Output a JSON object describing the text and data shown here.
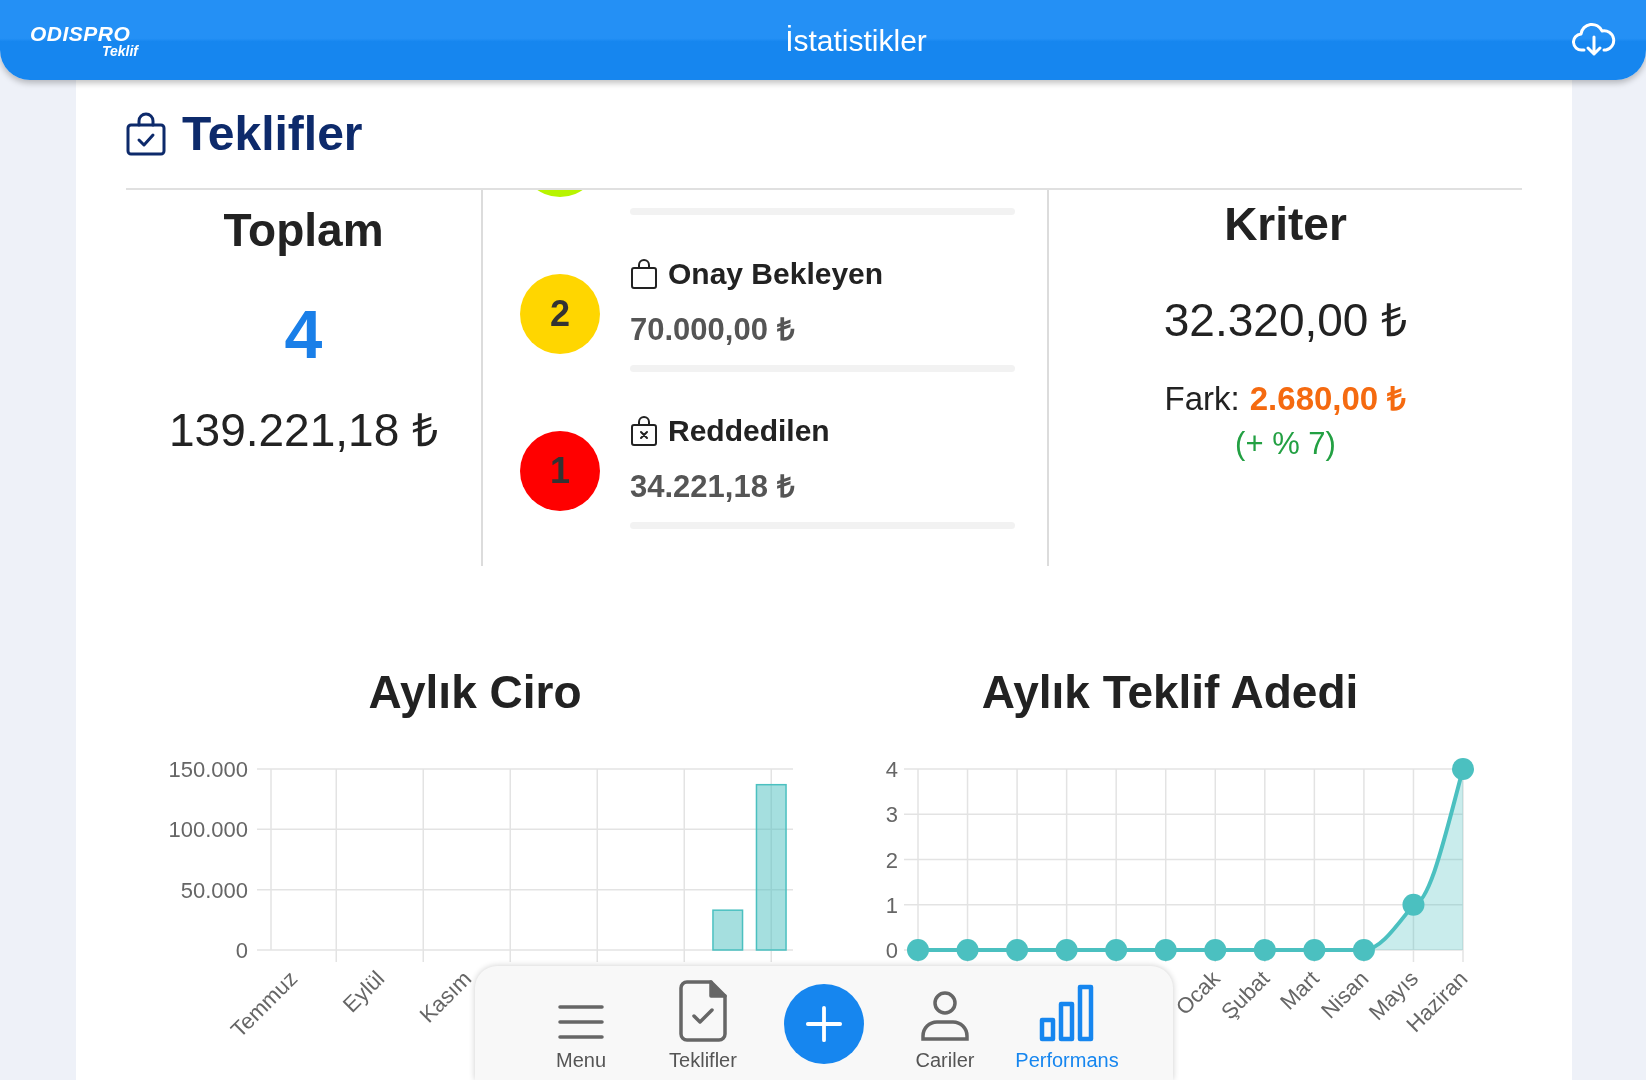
{
  "header": {
    "logo": "ODISPRO",
    "logo_sub": "Teklif",
    "title": "İstatistikler"
  },
  "section": {
    "title": "Teklifler"
  },
  "total": {
    "label": "Toplam",
    "count": "4",
    "amount": "139.221,18 ₺"
  },
  "statuses": [
    {
      "kind": "approved",
      "color": "#b7f400"
    },
    {
      "kind": "pending",
      "count": "2",
      "label": "Onay Bekleyen",
      "amount": "70.000,00 ₺",
      "color": "#ffd600"
    },
    {
      "kind": "rejected",
      "count": "1",
      "label": "Reddedilen",
      "amount": "34.221,18 ₺",
      "color": "#ff0000"
    }
  ],
  "criterion": {
    "label": "Kriter",
    "amount": "32.320,00 ₺",
    "difference_label": "Fark:",
    "difference": "2.680,00 ₺",
    "percent": "(+ % 7)"
  },
  "charts": [
    {
      "title": "Aylık Ciro",
      "chart_data": {
        "type": "bar",
        "categories": [
          "Temmuz",
          null,
          "Eylül",
          null,
          "Kasım",
          null,
          null,
          null,
          null,
          null,
          null,
          null
        ],
        "grid": true,
        "series": [
          {
            "color": "#4bc0c0",
            "values": [
              0,
              0,
              0,
              0,
              0,
              0,
              0,
              0,
              0,
              0,
              33000,
              137000
            ]
          }
        ],
        "ylim": [
          0,
          150000
        ],
        "yticks": [
          {
            "value": 0,
            "label": "0"
          },
          {
            "value": 50000,
            "label": "50.000"
          },
          {
            "value": 100000,
            "label": "100.000"
          },
          {
            "value": 150000,
            "label": "150.000"
          }
        ]
      }
    },
    {
      "title": "Aylık Teklif Adedi",
      "chart_data": {
        "type": "area",
        "categories": [
          null,
          null,
          null,
          null,
          null,
          null,
          "Ocak",
          "Şubat",
          "Mart",
          "Nisan",
          "Mayıs",
          "Haziran"
        ],
        "grid": true,
        "series": [
          {
            "color": "#4bc0c0",
            "values": [
              0,
              0,
              0,
              0,
              0,
              0,
              0,
              0,
              0,
              0,
              1,
              4
            ]
          }
        ],
        "ylim": [
          0,
          4
        ],
        "yticks": [
          0,
          1,
          2,
          3,
          4
        ]
      }
    }
  ],
  "bottom_nav": [
    {
      "kind": "menu",
      "label": "Menu",
      "selected": false
    },
    {
      "kind": "offers",
      "label": "Teklifler",
      "selected": false
    },
    {
      "kind": "add",
      "selected": false
    },
    {
      "kind": "contacts",
      "label": "Cariler",
      "selected": false
    },
    {
      "kind": "performance",
      "label": "Performans",
      "selected": true
    }
  ]
}
